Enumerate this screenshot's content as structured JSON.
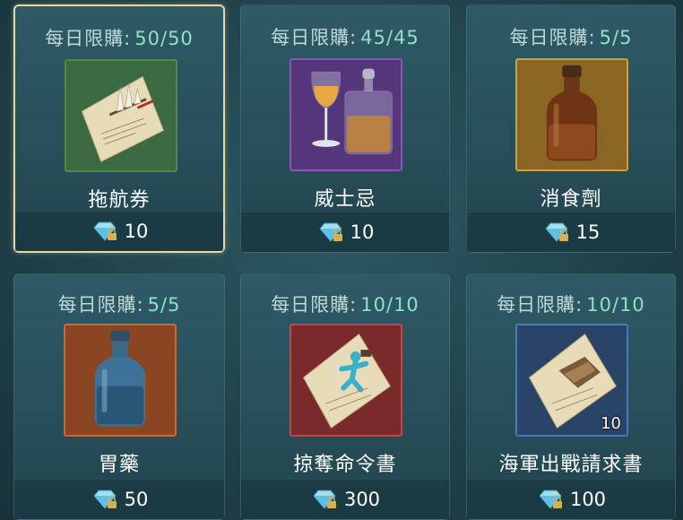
{
  "limit_label": "每日限購:",
  "items": [
    {
      "limit_count": "50/50",
      "name": "拖航券",
      "price": "10",
      "frame_color": "#4f8a4a",
      "icon": "sailing-ticket-icon"
    },
    {
      "limit_count": "45/45",
      "name": "威士忌",
      "price": "10",
      "frame_color": "#8a55b8",
      "icon": "whisky-icon"
    },
    {
      "limit_count": "5/5",
      "name": "消食劑",
      "price": "15",
      "frame_color": "#c9a43a",
      "icon": "amber-bottle-icon"
    },
    {
      "limit_count": "5/5",
      "name": "胃藥",
      "price": "50",
      "frame_color": "#c8693a",
      "icon": "blue-bottle-icon"
    },
    {
      "limit_count": "10/10",
      "name": "掠奪命令書",
      "price": "300",
      "frame_color": "#c04848",
      "icon": "plunder-order-icon"
    },
    {
      "limit_count": "10/10",
      "name": "海軍出戰請求書",
      "price": "100",
      "frame_color": "#4a78b8",
      "icon": "navy-request-icon",
      "quantity": "10"
    }
  ],
  "currency_icon": "locked-diamond-icon"
}
